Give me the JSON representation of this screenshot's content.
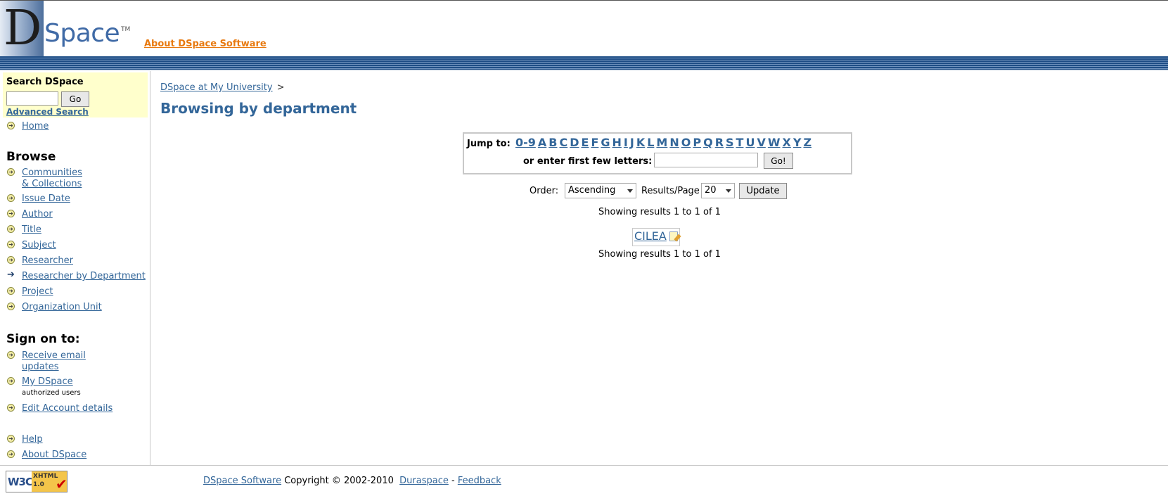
{
  "header": {
    "logo_letter": "D",
    "logo_word": "Space",
    "logo_tm": "TM",
    "about_link": "About DSpace Software"
  },
  "sidebar": {
    "search_title": "Search DSpace",
    "search_input_value": "",
    "search_go": "Go",
    "advanced_search": "Advanced Search",
    "home": "Home",
    "browse_title": "Browse",
    "browse_items": [
      {
        "line1": "Communities",
        "line2": "& Collections"
      },
      {
        "line1": "Issue Date"
      },
      {
        "line1": "Author"
      },
      {
        "line1": "Title"
      },
      {
        "line1": "Subject"
      },
      {
        "line1": "Researcher"
      },
      {
        "line1": "Researcher by Department"
      },
      {
        "line1": "Project"
      },
      {
        "line1": "Organization Unit"
      }
    ],
    "sign_on_title": "Sign on to:",
    "sign_items": [
      {
        "line1": "Receive email",
        "line2": "updates"
      },
      {
        "line1": "My DSpace",
        "sub": "authorized users"
      },
      {
        "line1": "Edit Account details"
      }
    ],
    "help": "Help",
    "about": "About DSpace"
  },
  "main": {
    "breadcrumb_link": "DSpace at My University",
    "breadcrumb_sep": ">",
    "title": "Browsing by department",
    "jump_label": "Jump to:",
    "jump_letters": [
      "0-9",
      "A",
      "B",
      "C",
      "D",
      "E",
      "F",
      "G",
      "H",
      "I",
      "J",
      "K",
      "L",
      "M",
      "N",
      "O",
      "P",
      "Q",
      "R",
      "S",
      "T",
      "U",
      "V",
      "W",
      "X",
      "Y",
      "Z"
    ],
    "starts_label": "or enter first few letters:",
    "starts_value": "",
    "starts_go": "Go!",
    "order_label": "Order:",
    "order_value": "Ascending",
    "rpp_label": "Results/Page",
    "rpp_value": "20",
    "update": "Update",
    "showing_top": "Showing results 1 to 1 of 1",
    "result_item": "CILEA",
    "showing_bottom": "Showing results 1 to 1 of 1"
  },
  "footer": {
    "badge_w3c": "W3C",
    "badge_line1": "XHTML",
    "badge_line2": "1.0",
    "link_software": "DSpace Software",
    "copyright": "Copyright © 2002-2010",
    "link_duraspace": "Duraspace",
    "dash": "-",
    "link_feedback": "Feedback"
  }
}
